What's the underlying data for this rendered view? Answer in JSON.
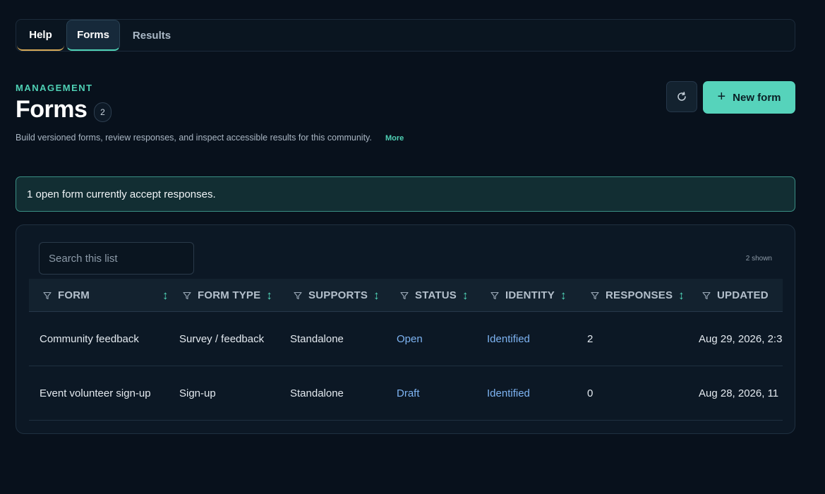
{
  "tabs": [
    {
      "label": "Help"
    },
    {
      "label": "Forms"
    },
    {
      "label": "Results"
    }
  ],
  "header": {
    "eyebrow": "MANAGEMENT",
    "title": "Forms",
    "count": "2",
    "description": "Build versioned forms, review responses, and inspect accessible results for this community.",
    "more_label": "More"
  },
  "actions": {
    "refresh_icon": "refresh-icon",
    "new_form_label": "New form"
  },
  "notice": "1 open form currently accept responses.",
  "table": {
    "search_placeholder": "Search this list",
    "shown_label": "2 shown",
    "columns": [
      "FORM",
      "FORM TYPE",
      "SUPPORTS",
      "STATUS",
      "IDENTITY",
      "RESPONSES",
      "UPDATED"
    ],
    "rows": [
      {
        "form": "Community feedback",
        "form_type": "Survey / feedback",
        "supports": "Standalone",
        "status": "Open",
        "identity": "Identified",
        "responses": "2",
        "updated": "Aug 29, 2026, 2:3"
      },
      {
        "form": "Event volunteer sign-up",
        "form_type": "Sign-up",
        "supports": "Standalone",
        "status": "Draft",
        "identity": "Identified",
        "responses": "0",
        "updated": "Aug 28, 2026, 11"
      }
    ]
  },
  "colors": {
    "accent": "#4fd1b5",
    "link": "#7eb4f3",
    "background": "#08111c",
    "help_underline": "#d6a957"
  }
}
